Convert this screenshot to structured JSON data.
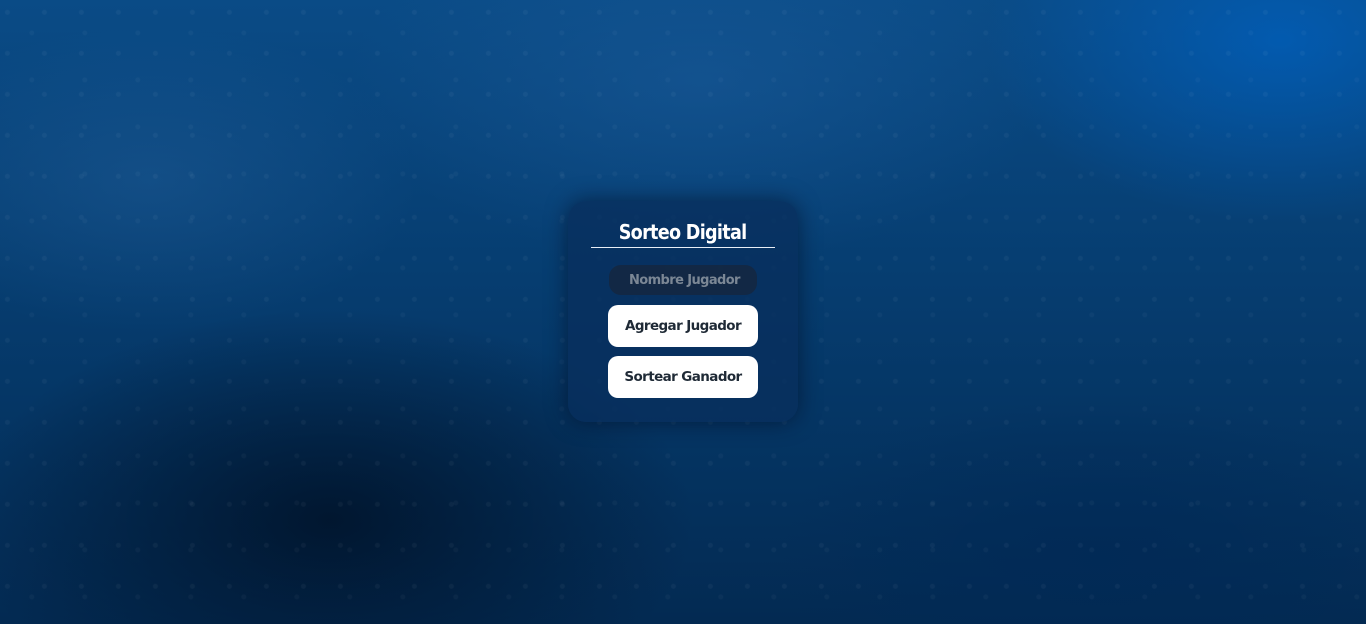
{
  "app": {
    "title": "Sorteo Digital"
  },
  "form": {
    "player_input": {
      "placeholder": "Nombre Jugador",
      "value": ""
    },
    "add_button_label": "Agregar Jugador",
    "draw_button_label": "Sortear Ganador"
  },
  "colors": {
    "background_primary": "#063d70",
    "card_background": "#0b2e5c",
    "button_background": "#ffffff",
    "button_text": "#1f2a36",
    "title_text": "#ffffff"
  }
}
